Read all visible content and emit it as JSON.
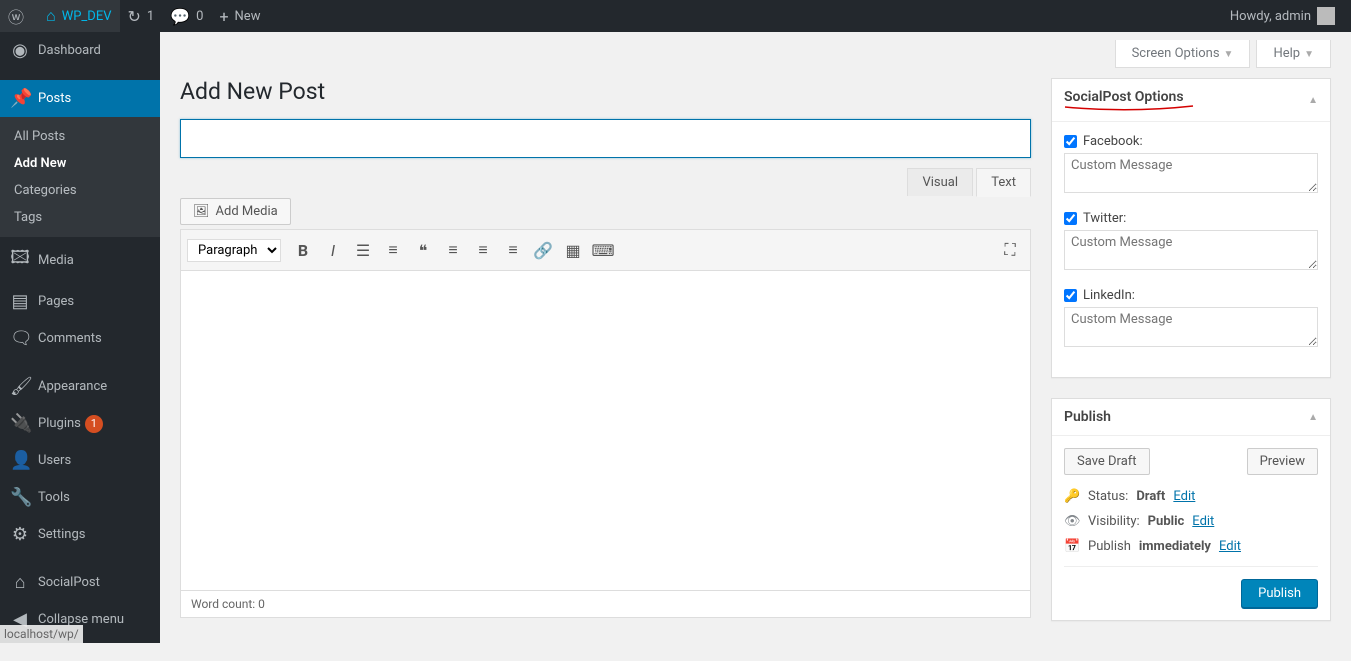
{
  "adminbar": {
    "site_name": "WP_DEV",
    "updates_count": "1",
    "comments_count": "0",
    "new_label": "New",
    "howdy": "Howdy, admin"
  },
  "sidebar": {
    "items": [
      {
        "label": "Dashboard",
        "icon": "⚙"
      },
      {
        "label": "Posts",
        "icon": "📌"
      },
      {
        "label": "Media",
        "icon": "🖼"
      },
      {
        "label": "Pages",
        "icon": "📄"
      },
      {
        "label": "Comments",
        "icon": "💬"
      },
      {
        "label": "Appearance",
        "icon": "🖌"
      },
      {
        "label": "Plugins",
        "icon": "🔌",
        "badgeCount": "1"
      },
      {
        "label": "Users",
        "icon": "👤"
      },
      {
        "label": "Tools",
        "icon": "🔧"
      },
      {
        "label": "Settings",
        "icon": "⚙"
      },
      {
        "label": "SocialPost",
        "icon": "⌂"
      }
    ],
    "posts_submenu": [
      "All Posts",
      "Add New",
      "Categories",
      "Tags"
    ],
    "collapse_label": "Collapse menu"
  },
  "screen_meta": {
    "screen_options": "Screen Options",
    "help": "Help"
  },
  "page_title": "Add New Post",
  "title_placeholder": "",
  "media_button": "Add Media",
  "editor_tabs": {
    "visual": "Visual",
    "text": "Text"
  },
  "format_select": "Paragraph",
  "word_count_label": "Word count: 0",
  "socialpost": {
    "title": "SocialPost Options",
    "networks": [
      {
        "label": "Facebook:",
        "placeholder": "Custom Message"
      },
      {
        "label": "Twitter:",
        "placeholder": "Custom Message"
      },
      {
        "label": "LinkedIn:",
        "placeholder": "Custom Message"
      }
    ]
  },
  "publish": {
    "title": "Publish",
    "save_draft": "Save Draft",
    "preview": "Preview",
    "status_label": "Status:",
    "status_value": "Draft",
    "visibility_label": "Visibility:",
    "visibility_value": "Public",
    "schedule_label": "Publish",
    "schedule_value": "immediately",
    "edit_label": "Edit",
    "publish_button": "Publish"
  },
  "footer_status": "localhost/wp/"
}
